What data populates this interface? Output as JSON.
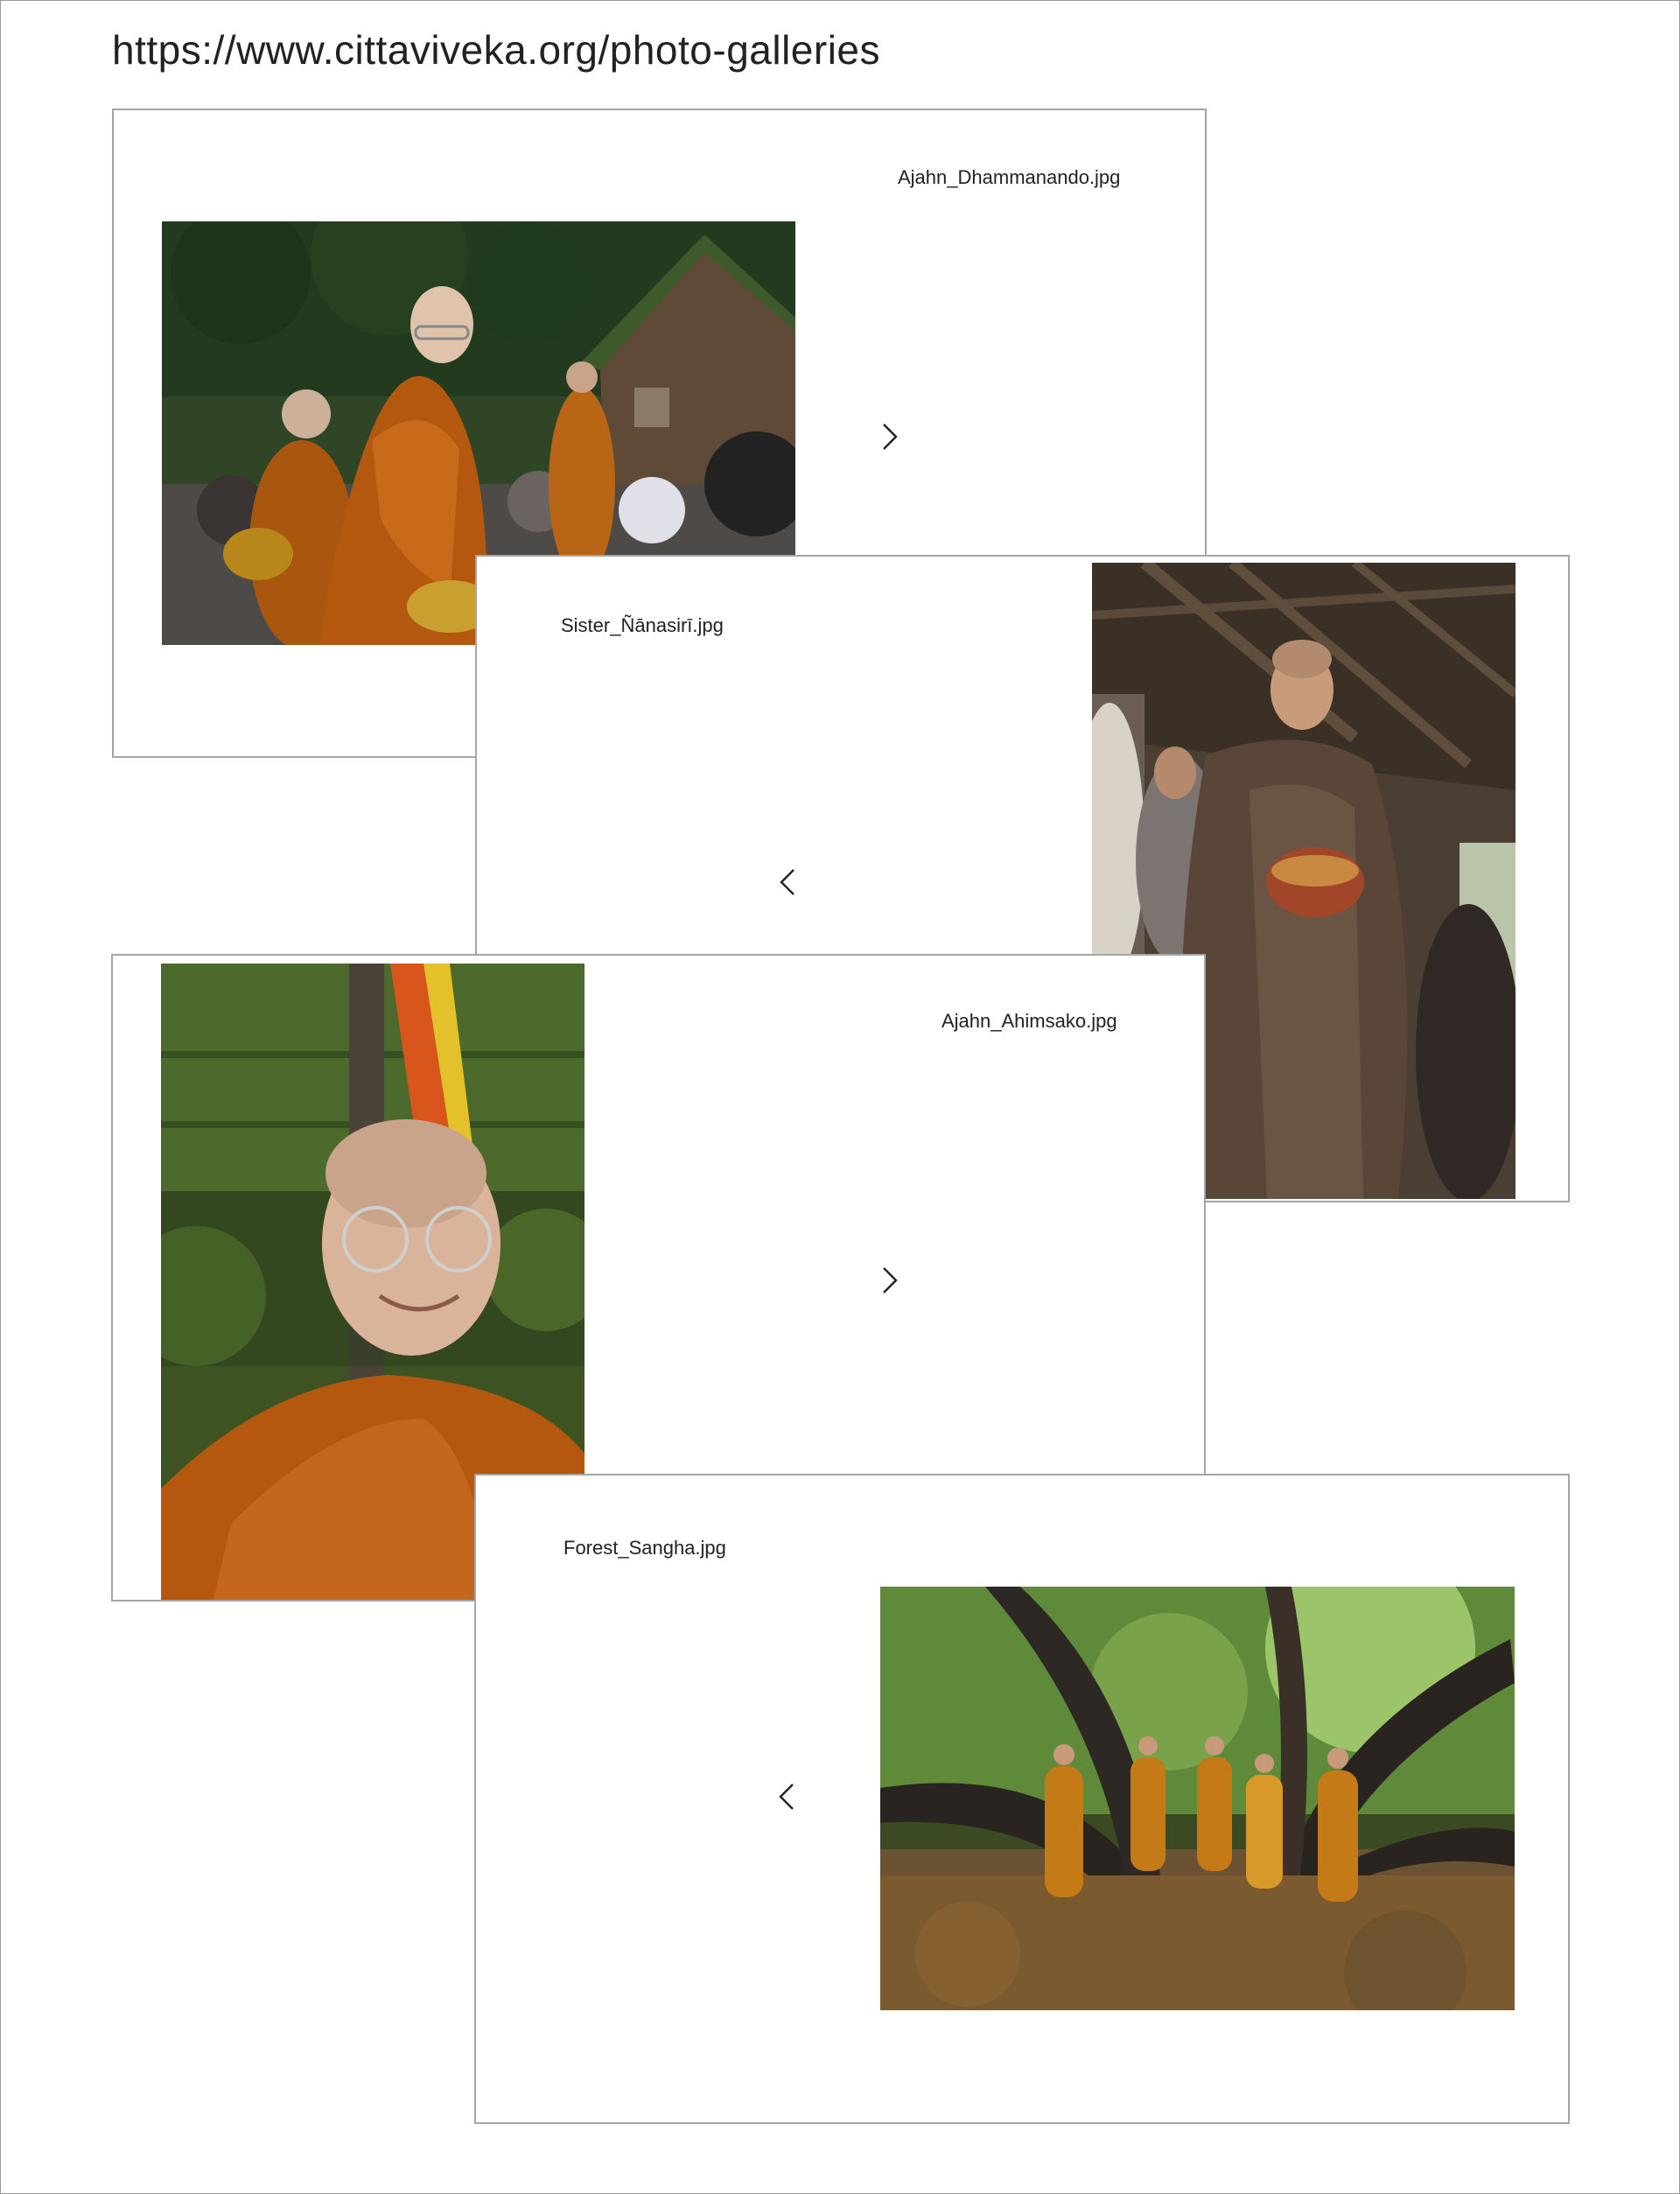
{
  "page": {
    "url": "https://www.cittaviveka.org/photo-galleries"
  },
  "cards": [
    {
      "caption": "Ajahn_Dhammanando.jpg",
      "nav_icon": "chevron-right-icon"
    },
    {
      "caption": "Sister_Ñānasirī.jpg",
      "nav_icon": "chevron-left-icon"
    },
    {
      "caption": "Ajahn_Ahimsako.jpg",
      "nav_icon": "chevron-right-icon"
    },
    {
      "caption": "Forest_Sangha.jpg",
      "nav_icon": "chevron-left-icon"
    }
  ],
  "colors": {
    "robe_orange": "#b5580f",
    "robe_brown": "#5a4638",
    "foliage": "#3f5a26",
    "card_border": "#a5a5a5"
  }
}
